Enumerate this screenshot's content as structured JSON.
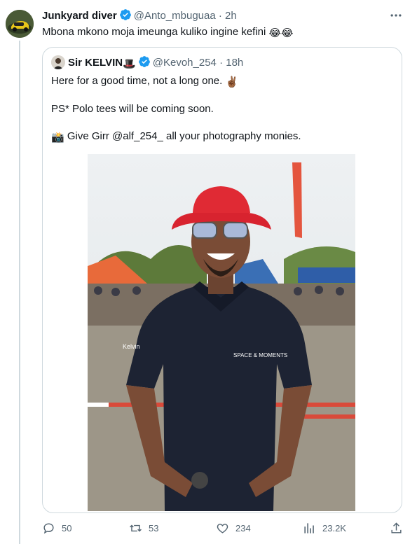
{
  "tweet": {
    "author_name": "Junkyard diver",
    "handle": "@Anto_mbuguaa",
    "time": "· 2h",
    "text": "Mbona mkono moja imeunga kuliko ingine kefini",
    "text_emoji": "😂😂"
  },
  "quote": {
    "author_name": "Sir KELVIN",
    "name_emoji": "🎩",
    "handle": "@Kevoh_254",
    "time": "· 18h",
    "line1": "Here for a good time, not a long one.",
    "line1_emoji": "✌🏾",
    "line2": "PS* Polo tees will be coming soon.",
    "line3_emoji": "📸",
    "line3": "Give Girr @alf_254_ all your photography monies.",
    "photo_shirt_text": "SPACE & MOMENTS",
    "photo_sleeve_text": "Kelvin"
  },
  "actions": {
    "replies": "50",
    "retweets": "53",
    "likes": "234",
    "views": "23.2K"
  },
  "icons": {
    "verified": "verified-badge-icon",
    "more": "more-icon",
    "reply": "reply-icon",
    "retweet": "retweet-icon",
    "like": "heart-icon",
    "views": "views-icon",
    "share": "share-icon"
  },
  "colors": {
    "verified": "#1d9bf0",
    "text": "#0f1419",
    "muted": "#536471",
    "border": "#cfd9de"
  }
}
